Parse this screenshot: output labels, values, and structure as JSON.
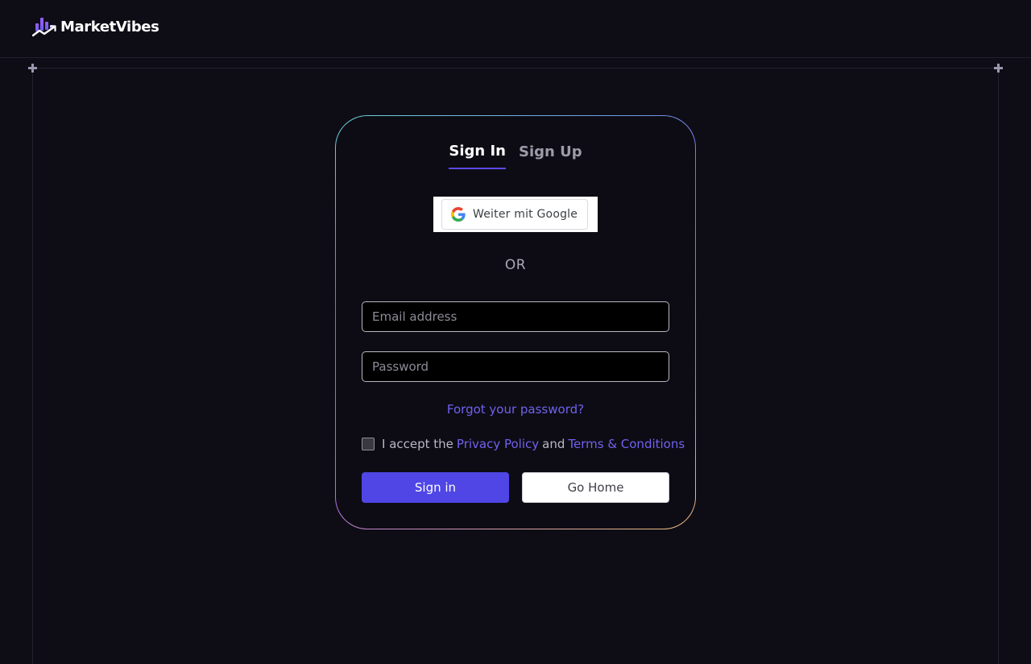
{
  "brand": {
    "name": "MarketVibes"
  },
  "tabs": [
    {
      "label": "Sign In",
      "active": true
    },
    {
      "label": "Sign Up",
      "active": false
    }
  ],
  "google": {
    "label": "Weiter mit Google"
  },
  "divider": {
    "label": "OR"
  },
  "form": {
    "email_placeholder": "Email address",
    "password_placeholder": "Password",
    "forgot_label": "Forgot your password?"
  },
  "terms": {
    "prefix": "I accept the",
    "privacy_label": "Privacy Policy",
    "and": "and",
    "terms_label": "Terms & Conditions",
    "checked": false
  },
  "actions": {
    "sign_in_label": "Sign in",
    "go_home_label": "Go Home"
  },
  "colors": {
    "background": "#0e0d16",
    "accent": "#4f46e5",
    "link": "#6f62ee"
  },
  "icons": {
    "logo": "bar-chart-trend-logo",
    "google": "google-g-icon"
  }
}
